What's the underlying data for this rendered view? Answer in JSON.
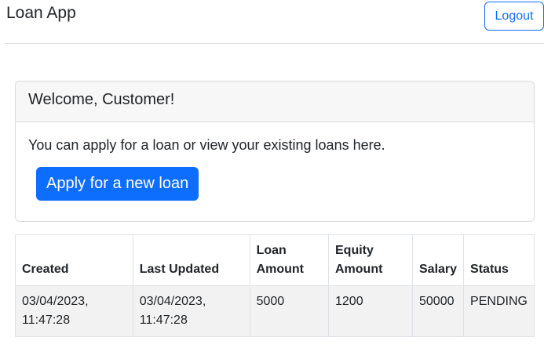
{
  "navbar": {
    "brand": "Loan App",
    "logout_label": "Logout"
  },
  "welcome_card": {
    "header": "Welcome, Customer!",
    "text": "You can apply for a loan or view your existing loans here.",
    "apply_label": "Apply for a new loan"
  },
  "loans_table": {
    "headers": [
      "Created",
      "Last Updated",
      "Loan Amount",
      "Equity Amount",
      "Salary",
      "Status"
    ],
    "rows": [
      [
        "03/04/2023, 11:47:28",
        "03/04/2023, 11:47:28",
        "5000",
        "1200",
        "50000",
        "PENDING"
      ]
    ]
  },
  "colors": {
    "primary": "#0d6efd",
    "border": "#dee2e6",
    "row_bg": "#f2f2f2"
  }
}
